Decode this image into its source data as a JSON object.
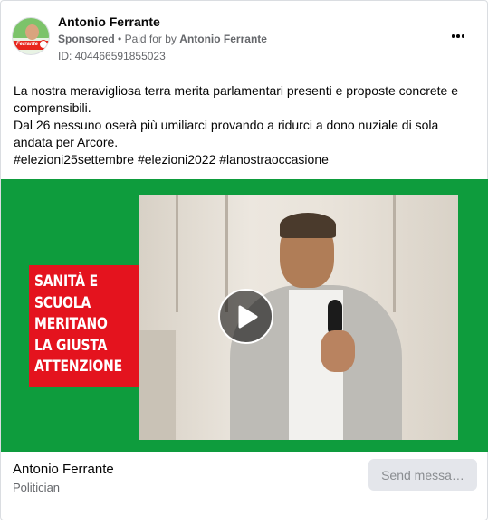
{
  "header": {
    "page_name": "Antonio Ferrante",
    "sponsored": "Sponsored",
    "separator": "•",
    "paid_for_by": "Paid for by",
    "paid_name": "Antonio Ferrante",
    "ad_id": "ID: 404466591855023",
    "avatar_logo_text": "Ferrante",
    "more_icon": "more-horizontal-icon"
  },
  "body": {
    "lines": [
      "La nostra meravigliosa terra merita parlamentari presenti e proposte concrete e comprensibili.",
      "Dal 26 nessuno oserà più umiliarci provando a ridurci a dono nuziale di sola andata per Arcore.",
      "#elezioni25settembre #elezioni2022 #lanostraoccasione"
    ]
  },
  "media": {
    "banner_lines": [
      "SANITÀ E",
      "SCUOLA",
      "MERITANO",
      "LA GIUSTA",
      "ATTENZIONE"
    ],
    "play_icon": "play-icon",
    "colors": {
      "background": "#0e9c3d",
      "banner": "#e4131e"
    }
  },
  "footer": {
    "name": "Antonio Ferrante",
    "category": "Politician",
    "send_button": "Send messa…"
  }
}
